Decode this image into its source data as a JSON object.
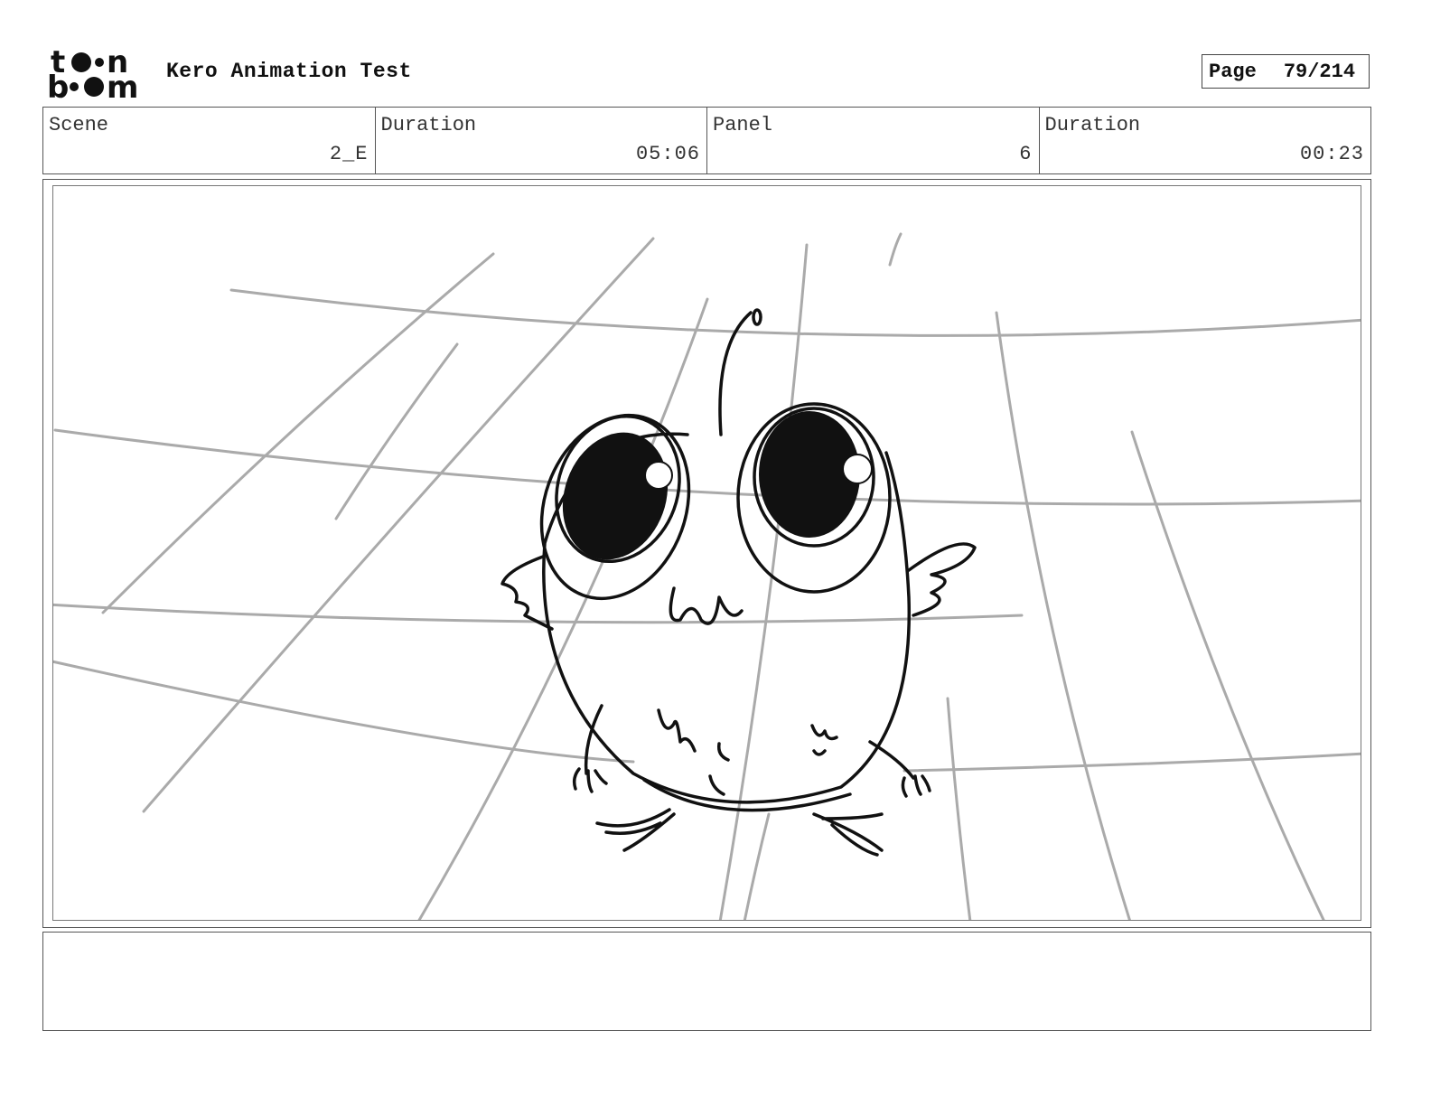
{
  "header": {
    "logo_icon": "toonboom-logo",
    "project_title": "Kero Animation Test",
    "page_label": "Page",
    "page_number": "79/214"
  },
  "info": [
    {
      "label": "Scene",
      "value": "2_E"
    },
    {
      "label": "Duration",
      "value": "05:06"
    },
    {
      "label": "Panel",
      "value": "6"
    },
    {
      "label": "Duration",
      "value": "00:23"
    }
  ],
  "panel": {
    "drawing_icon": "kero-creature-sketch"
  },
  "notes": {
    "text": ""
  }
}
